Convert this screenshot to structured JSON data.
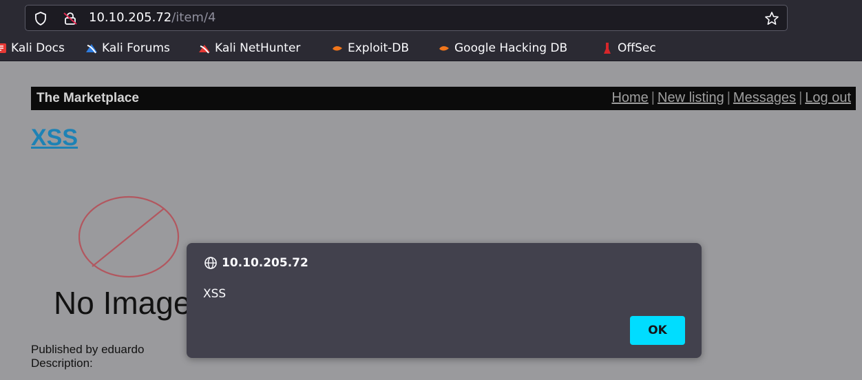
{
  "browser": {
    "url_host": "10.10.205.72",
    "url_path": "/item/4",
    "bookmarks": [
      {
        "label": "Kali Docs",
        "icon": "kali-docs-icon"
      },
      {
        "label": "Kali Forums",
        "icon": "kali-forums-icon"
      },
      {
        "label": "Kali NetHunter",
        "icon": "kali-nethunter-icon"
      },
      {
        "label": "Exploit-DB",
        "icon": "exploit-db-icon"
      },
      {
        "label": "Google Hacking DB",
        "icon": "google-hacking-db-icon"
      },
      {
        "label": "OffSec",
        "icon": "offsec-icon"
      }
    ]
  },
  "page": {
    "brand": "The Marketplace",
    "nav": {
      "home": "Home",
      "new_listing": "New listing",
      "messages": "Messages",
      "logout": "Log out",
      "separator": "|"
    },
    "item_title": "XSS",
    "no_image_text": "No Image",
    "published_by": "Published by eduardo",
    "description_label": "Description:"
  },
  "dialog": {
    "origin": "10.10.205.72",
    "message": "XSS",
    "ok_label": "OK"
  },
  "colors": {
    "accent": "#00ddff",
    "link_title": "#1d82b5",
    "chrome_bg": "#2b2a33"
  }
}
